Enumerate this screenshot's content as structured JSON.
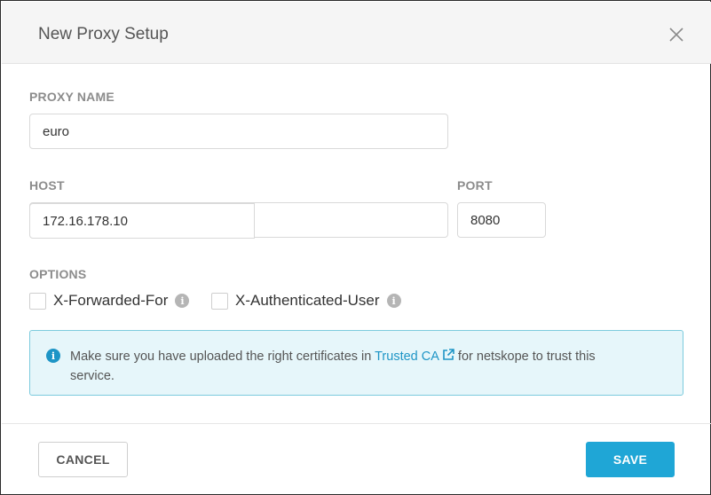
{
  "dialog": {
    "title": "New Proxy Setup",
    "close_icon": "close-icon"
  },
  "fields": {
    "proxy_name": {
      "label": "PROXY NAME",
      "value": "euro"
    },
    "host": {
      "label": "HOST",
      "value": "172.16.178.10"
    },
    "port": {
      "label": "PORT",
      "value": "8080"
    }
  },
  "options": {
    "label": "OPTIONS",
    "items": [
      {
        "label": "X-Forwarded-For",
        "checked": false,
        "icon": "info-icon"
      },
      {
        "label": "X-Authenticated-User",
        "checked": false,
        "icon": "info-icon"
      }
    ]
  },
  "notice": {
    "icon": "info-icon",
    "text_before": "Make sure you have uploaded the right certificates in ",
    "link_text": "Trusted CA",
    "link_icon": "external-link-icon",
    "text_after": " for netskope to trust this service."
  },
  "footer": {
    "cancel_label": "CANCEL",
    "save_label": "SAVE"
  },
  "colors": {
    "accent": "#1fa6d6",
    "notice_bg": "#e6f6fa",
    "notice_border": "#7ccbdd"
  }
}
